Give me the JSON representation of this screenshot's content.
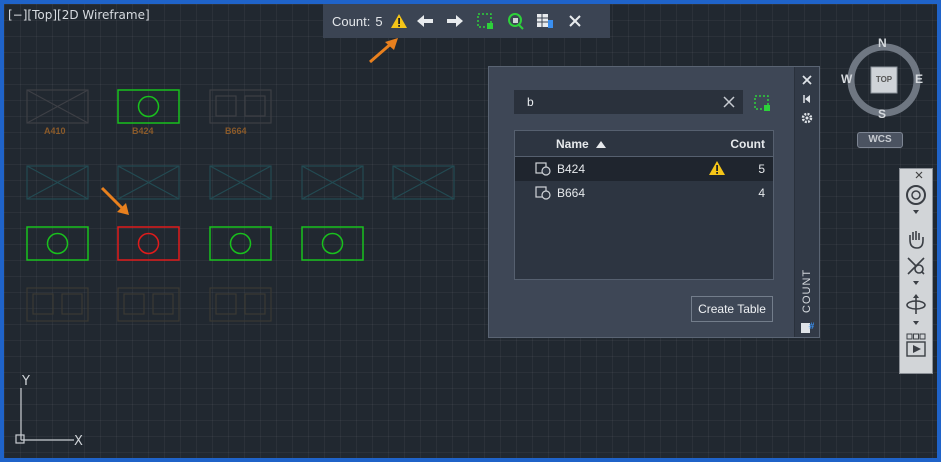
{
  "viewport": {
    "label": "[−][Top][2D Wireframe]"
  },
  "drawing": {
    "block_labels": [
      "A410",
      "B424",
      "B664"
    ]
  },
  "count_toolbar": {
    "label": "Count:",
    "value": "5",
    "icons": [
      "warning-icon",
      "arrow-left-icon",
      "arrow-right-icon",
      "select-objects-icon",
      "zoom-to-object-icon",
      "create-table-icon",
      "close-icon"
    ]
  },
  "count_palette": {
    "title": "COUNT",
    "search": {
      "value": "b"
    },
    "columns": {
      "name": "Name",
      "count": "Count"
    },
    "rows": [
      {
        "name": "B424",
        "count": "5",
        "warning": true
      },
      {
        "name": "B664",
        "count": "4",
        "warning": false
      }
    ],
    "create_table_label": "Create Table"
  },
  "viewcube": {
    "north": "N",
    "south": "S",
    "east": "E",
    "west": "W",
    "face": "TOP",
    "ucs_button": "WCS"
  },
  "ucs_icon": {
    "x": "X",
    "y": "Y"
  },
  "colors": {
    "accent_border": "#1f63c9",
    "annotation_arrow": "#e8801e",
    "warning": "#f5c518",
    "block_ok": "#19c11d",
    "block_error": "#e01b1b"
  }
}
